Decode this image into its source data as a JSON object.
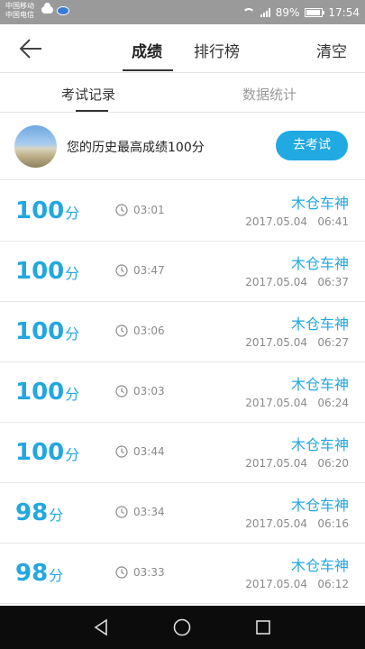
{
  "status_bar": {
    "carrier_1": "中国移动",
    "carrier_2": "中国电信",
    "battery_text": "89%",
    "time": "17:54"
  },
  "header": {
    "tabs": [
      {
        "label": "成绩",
        "active": true
      },
      {
        "label": "排行榜",
        "active": false
      }
    ],
    "clear_label": "清空"
  },
  "sub_tabs": [
    {
      "label": "考试记录",
      "active": true
    },
    {
      "label": "数据统计",
      "active": false
    }
  ],
  "best": {
    "text": "您的历史最高成绩100分",
    "button_label": "去考试"
  },
  "records": [
    {
      "score": "100",
      "unit": "分",
      "duration": "03:01",
      "name": "木仓车神",
      "date": "2017.05.04   06:41"
    },
    {
      "score": "100",
      "unit": "分",
      "duration": "03:47",
      "name": "木仓车神",
      "date": "2017.05.04   06:37"
    },
    {
      "score": "100",
      "unit": "分",
      "duration": "03:06",
      "name": "木仓车神",
      "date": "2017.05.04   06:27"
    },
    {
      "score": "100",
      "unit": "分",
      "duration": "03:03",
      "name": "木仓车神",
      "date": "2017.05.04   06:24"
    },
    {
      "score": "100",
      "unit": "分",
      "duration": "03:44",
      "name": "木仓车神",
      "date": "2017.05.04   06:20"
    },
    {
      "score": "98",
      "unit": "分",
      "duration": "03:34",
      "name": "木仓车神",
      "date": "2017.05.04   06:16"
    },
    {
      "score": "98",
      "unit": "分",
      "duration": "03:33",
      "name": "木仓车神",
      "date": "2017.05.04   06:12"
    }
  ],
  "colors": {
    "accent": "#22a7e0",
    "button": "#21a9e1",
    "status_bar": "#9a9a9a",
    "nav_bar": "#0c0c0c"
  },
  "icons": {
    "back": "arrow-left-icon",
    "clock": "clock-icon",
    "nav_back": "triangle-back-icon",
    "nav_home": "circle-home-icon",
    "nav_recent": "square-recent-icon"
  }
}
